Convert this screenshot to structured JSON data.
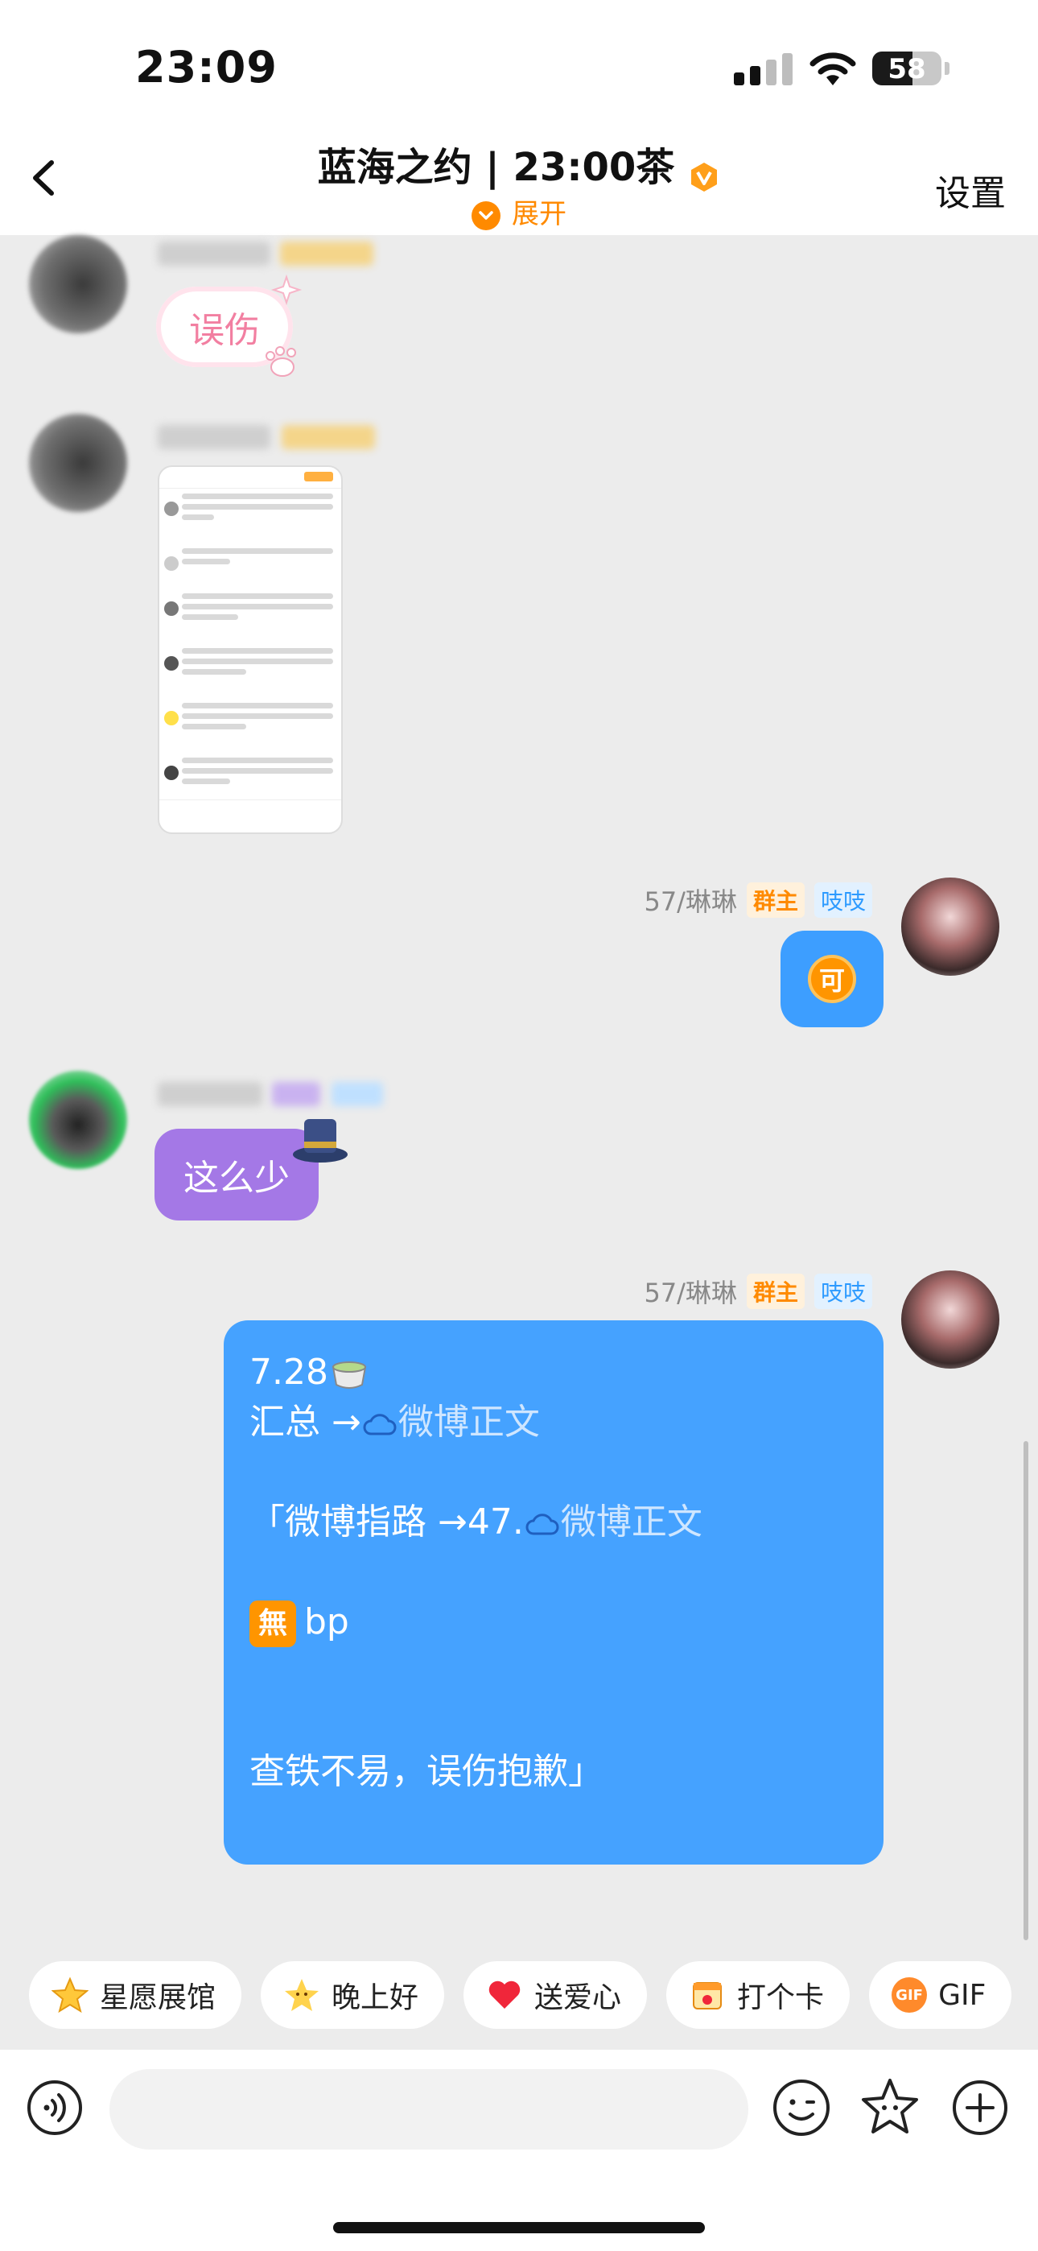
{
  "status_bar": {
    "time": "23:09",
    "battery": "58",
    "battery_level": 0.58
  },
  "nav": {
    "title": "蓝海之约 | 23:00茶",
    "expand_label": "展开",
    "settings_label": "设置"
  },
  "messages": {
    "m1": {
      "sticker_text": "误伤"
    },
    "m3": {
      "sender_name": "57/琳琳",
      "badge_owner": "群主",
      "badge_tag": "吱吱",
      "emoji_text": "可"
    },
    "m4": {
      "text": "这么少"
    },
    "m5": {
      "sender_name": "57/琳琳",
      "badge_owner": "群主",
      "badge_tag": "吱吱",
      "line1": "7.28",
      "line2_prefix": "汇总 →",
      "line2_link": "微博正文",
      "line3_prefix": "「微博指路 →47.",
      "line3_link": "微博正文",
      "line4_icon": "無",
      "line4_text": "bp",
      "line5": "查铁不易，误伤抱歉」"
    }
  },
  "quick_actions": [
    {
      "label": "星愿展馆",
      "icon": "star-icon"
    },
    {
      "label": "晚上好",
      "icon": "star-face-icon"
    },
    {
      "label": "送爱心",
      "icon": "heart-icon"
    },
    {
      "label": "打个卡",
      "icon": "calendar-icon"
    },
    {
      "label": "GIF",
      "icon": "gif-icon"
    }
  ],
  "input": {
    "placeholder": ""
  },
  "colors": {
    "accent": "#ff8a00",
    "bubble_blue": "#45a2ff",
    "bubble_purple": "#a478e6"
  }
}
